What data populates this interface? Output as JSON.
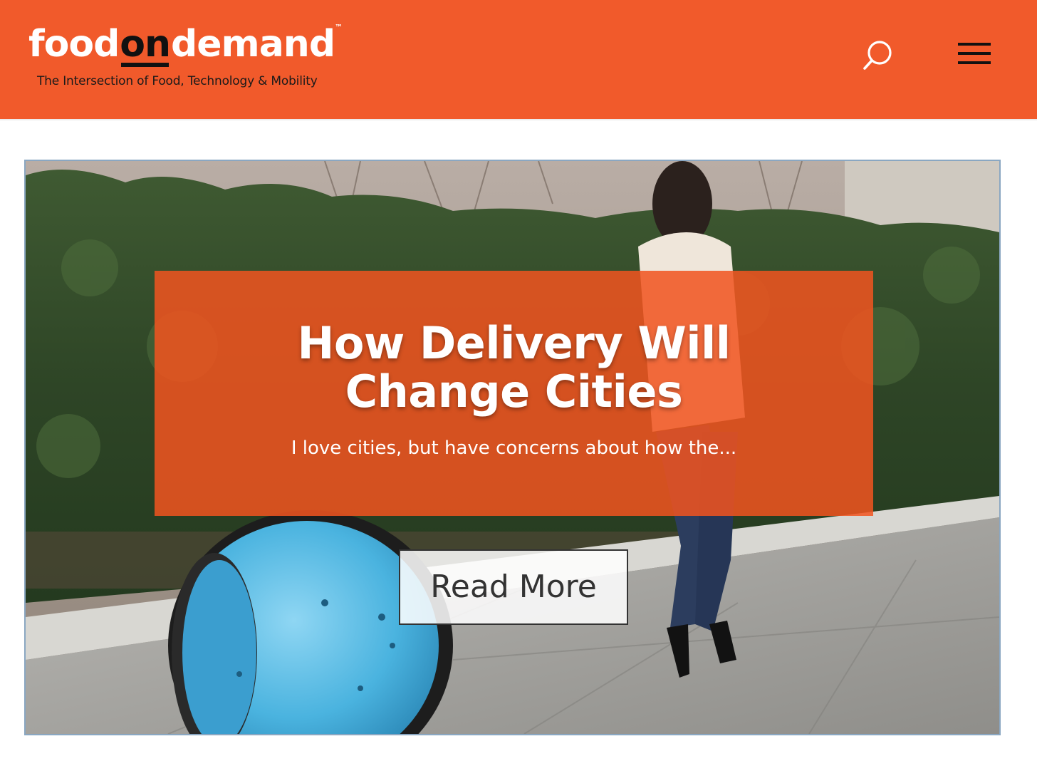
{
  "header": {
    "logo": {
      "text_food": "food",
      "text_on": "on",
      "text_demand": "demand",
      "trademark": "™",
      "tagline": "The Intersection of Food, Technology & Mobility"
    },
    "search_icon": "search-icon",
    "menu_icon": "hamburger-menu-icon"
  },
  "hero": {
    "title": "How Delivery Will Change Cities",
    "excerpt": "I love cities, but have concerns about how the...",
    "read_more_label": "Read More",
    "image_subject": "woman walking on sidewalk followed by a blue rolling delivery robot"
  },
  "colors": {
    "brand_orange": "#f15a2b",
    "overlay_orange": "#f15420",
    "text_dark": "#111111",
    "hero_border": "#8aa7c2",
    "robot_blue": "#4ab3df"
  }
}
